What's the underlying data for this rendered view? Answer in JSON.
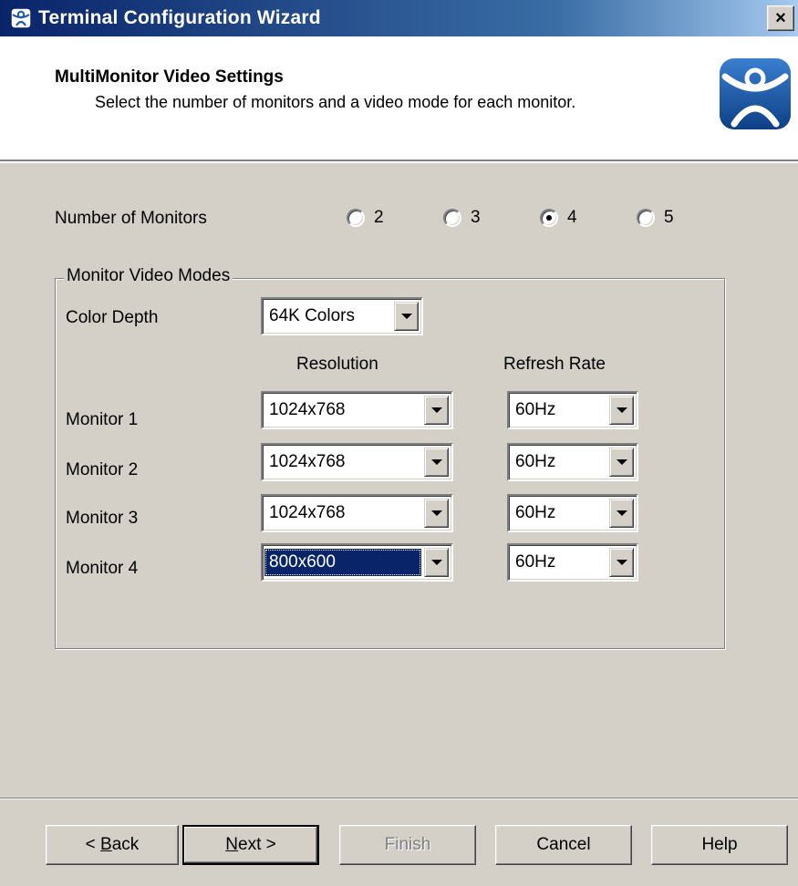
{
  "window": {
    "title": "Terminal Configuration Wizard",
    "close_label": "×"
  },
  "header": {
    "title": "MultiMonitor Video Settings",
    "subtitle": "Select the number of monitors and a video mode for each monitor.",
    "logo_icon": "thinmanager-logo-icon"
  },
  "monitors_count": {
    "label": "Number of Monitors",
    "options": [
      {
        "label": "2",
        "checked": false
      },
      {
        "label": "3",
        "checked": false
      },
      {
        "label": "4",
        "checked": true
      },
      {
        "label": "5",
        "checked": false
      }
    ]
  },
  "video_modes": {
    "legend": "Monitor Video Modes",
    "color_depth_label": "Color Depth",
    "color_depth_value": "64K Colors",
    "resolution_header": "Resolution",
    "refresh_header": "Refresh Rate",
    "monitors": [
      {
        "label": "Monitor 1",
        "resolution": "1024x768",
        "refresh": "60Hz"
      },
      {
        "label": "Monitor 2",
        "resolution": "1024x768",
        "refresh": "60Hz"
      },
      {
        "label": "Monitor 3",
        "resolution": "1024x768",
        "refresh": "60Hz"
      },
      {
        "label": "Monitor 4",
        "resolution": "800x600",
        "refresh": "60Hz"
      }
    ]
  },
  "buttons": {
    "back_prefix": "< ",
    "back_mnemonic": "B",
    "back_rest": "ack",
    "next_mnemonic": "N",
    "next_rest": "ext >",
    "finish": "Finish",
    "cancel": "Cancel",
    "help": "Help"
  },
  "colors": {
    "title_gradient_start": "#0a246a",
    "face": "#d4d0c8",
    "selection": "#0a246a",
    "logo_blue": "#1e5aa8"
  }
}
